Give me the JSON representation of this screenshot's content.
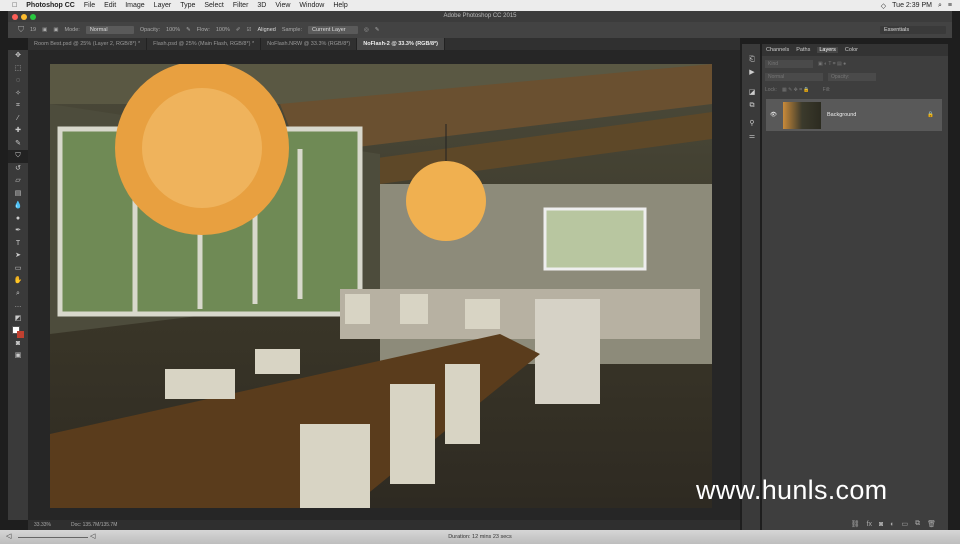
{
  "menubar": {
    "app": "Photoshop CC",
    "items": [
      "File",
      "Edit",
      "Image",
      "Layer",
      "Type",
      "Select",
      "Filter",
      "3D",
      "View",
      "Window",
      "Help"
    ],
    "clock": "Tue 2:39 PM"
  },
  "window": {
    "title": "Adobe Photoshop CC 2015"
  },
  "options": {
    "size": "19",
    "mode_label": "Mode:",
    "mode": "Normal",
    "opacity_label": "Opacity:",
    "opacity": "100%",
    "flow_label": "Flow:",
    "flow": "100%",
    "aligned": "Aligned",
    "sample_label": "Sample:",
    "sample": "Current Layer",
    "workspace": "Essentials"
  },
  "tabs": [
    {
      "label": "Room Best.psd @ 25% (Layer 2, RGB/8*) *"
    },
    {
      "label": "Flash.psd @ 25% (Main Flash, RGB/8*) *"
    },
    {
      "label": "NoFlash.NRW @ 33.3% (RGB/8*)"
    },
    {
      "label": "NoFlash-2 @ 33.3% (RGB/8*)"
    }
  ],
  "panel": {
    "tabs": [
      "Channels",
      "Paths",
      "Layers",
      "Color"
    ],
    "kind": "Kind",
    "blend": "Normal",
    "opacity": "Opacity:",
    "lock": "Lock:",
    "fill": "Fill:",
    "layer_name": "Background"
  },
  "status": {
    "zoom": "33.33%",
    "doc": "Doc: 135.7M/135.7M"
  },
  "bottom": {
    "duration": "Duration: 12 mins 23 secs"
  },
  "watermark": "www.hunls.com"
}
